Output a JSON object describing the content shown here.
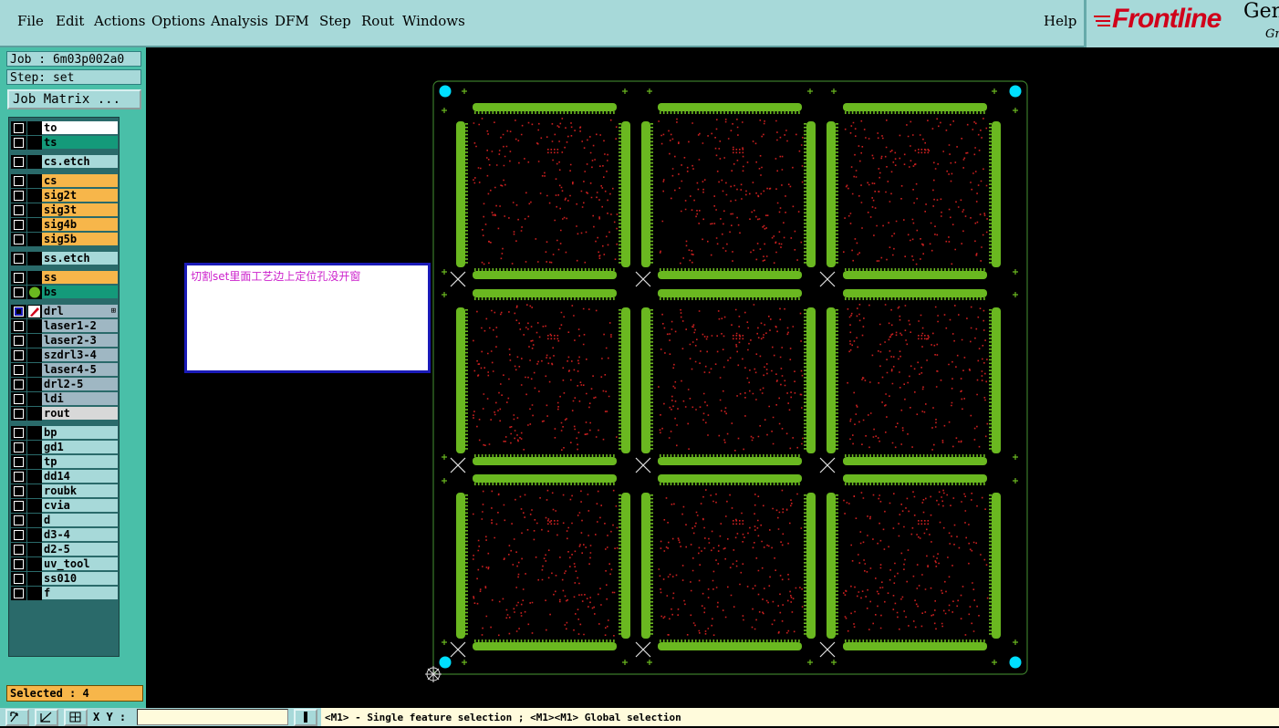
{
  "menu": {
    "items": [
      "File",
      "Edit",
      "Actions",
      "Options",
      "Analysis",
      "DFM",
      "Step",
      "Rout",
      "Windows"
    ],
    "help": "Help"
  },
  "logo": {
    "brand": "Frontline",
    "product": "Gen",
    "subtitle": "Gro"
  },
  "job": {
    "label": "Job : 6m03p002a0",
    "step": "Step: set",
    "matrix_button": "Job Matrix ..."
  },
  "layers": [
    {
      "name": "to",
      "color": "#ffffff",
      "group": 0
    },
    {
      "name": "ts",
      "color": "#149a7a",
      "group": 0
    },
    {
      "name": "cs.etch",
      "color": "#a7d9d9",
      "group": 1
    },
    {
      "name": "cs",
      "color": "#f7b64a",
      "group": 2
    },
    {
      "name": "sig2t",
      "color": "#f7b64a",
      "group": 2
    },
    {
      "name": "sig3t",
      "color": "#f7b64a",
      "group": 2
    },
    {
      "name": "sig4b",
      "color": "#f7b64a",
      "group": 2
    },
    {
      "name": "sig5b",
      "color": "#f7b64a",
      "group": 2
    },
    {
      "name": "ss.etch",
      "color": "#a7d9d9",
      "group": 3
    },
    {
      "name": "ss",
      "color": "#f7b64a",
      "group": 4
    },
    {
      "name": "bs",
      "color": "#149a7a",
      "group": 4,
      "icon": "green-dot-icon"
    },
    {
      "name": "drl",
      "color": "#9fb7c3",
      "group": 5,
      "icon": "edit-cursor-icon",
      "active": true
    },
    {
      "name": "laser1-2",
      "color": "#9fb7c3",
      "group": 5
    },
    {
      "name": "laser2-3",
      "color": "#9fb7c3",
      "group": 5
    },
    {
      "name": "szdrl3-4",
      "color": "#9fb7c3",
      "group": 5
    },
    {
      "name": "laser4-5",
      "color": "#9fb7c3",
      "group": 5
    },
    {
      "name": "drl2-5",
      "color": "#9fb7c3",
      "group": 5
    },
    {
      "name": "ldi",
      "color": "#9fb7c3",
      "group": 5
    },
    {
      "name": "rout",
      "color": "#d8d8d8",
      "group": 5
    },
    {
      "name": "bp",
      "color": "#a7d9d9",
      "group": 6
    },
    {
      "name": "gd1",
      "color": "#a7d9d9",
      "group": 6
    },
    {
      "name": "tp",
      "color": "#a7d9d9",
      "group": 6
    },
    {
      "name": "dd14",
      "color": "#a7d9d9",
      "group": 6
    },
    {
      "name": "roubk",
      "color": "#a7d9d9",
      "group": 6
    },
    {
      "name": "cvia",
      "color": "#a7d9d9",
      "group": 6
    },
    {
      "name": "d",
      "color": "#a7d9d9",
      "group": 6
    },
    {
      "name": "d3-4",
      "color": "#a7d9d9",
      "group": 6
    },
    {
      "name": "d2-5",
      "color": "#a7d9d9",
      "group": 6
    },
    {
      "name": "uv_tool",
      "color": "#a7d9d9",
      "group": 6
    },
    {
      "name": "ss010",
      "color": "#a7d9d9",
      "group": 6
    },
    {
      "name": "f",
      "color": "#a7d9d9",
      "group": 6
    }
  ],
  "selected": "Selected : 4",
  "bottom": {
    "xy_label": "X Y :",
    "xy_value": "",
    "status": "<M1> - Single feature selection ; <M1><M1> Global selection",
    "buttons": [
      "zoom-fit-icon",
      "measure-icon",
      "grid-icon",
      "info-icon"
    ]
  },
  "annotation": {
    "text": "切割set里面工艺边上定位孔没开窗"
  },
  "colors": {
    "menu_bg": "#a7d9d9",
    "panel_bg": "#49bfa8",
    "canvas_bg": "#000000",
    "board_outline": "#3a7a2a",
    "copper": "#6ab820",
    "drill": "#cc2020",
    "fiducial": "#00e0ff"
  }
}
